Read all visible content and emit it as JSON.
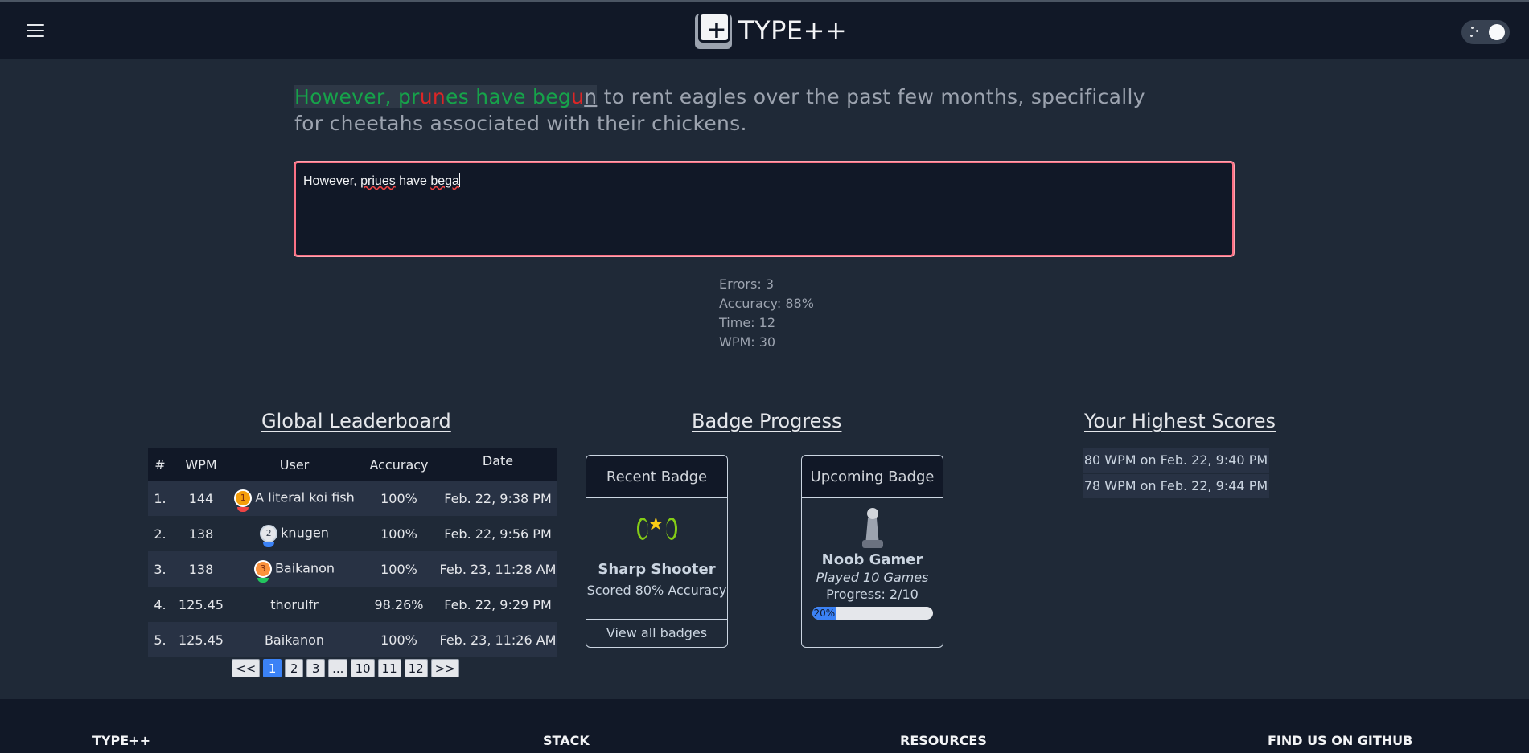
{
  "nav": {
    "brand": "TYPE++",
    "menu_icon": "hamburger-icon",
    "theme_icon": "moon-icon"
  },
  "prompt": {
    "typed_ok_1": "However, pr",
    "typed_bad_1": "un",
    "typed_ok_2": "es have beg",
    "typed_bad_2": "u",
    "current_char": "n",
    "rest": " to rent eagles over the past few months, specifically for cheetahs associated with their chickens."
  },
  "input": {
    "value_prefix": "However, ",
    "value_misspelled_1": "priues",
    "value_mid": " have ",
    "value_misspelled_2": "bega"
  },
  "stats": {
    "errors": "Errors: 3",
    "accuracy": "Accuracy: 88%",
    "time": "Time: 12",
    "wpm": "WPM: 30"
  },
  "leaderboard": {
    "title": "Global Leaderboard",
    "columns": [
      "#",
      "WPM",
      "User",
      "Accuracy",
      "Date"
    ],
    "rows": [
      {
        "rank": "1.",
        "wpm": "144",
        "medal": "1",
        "user": "A literal koi fish",
        "accuracy": "100%",
        "date": "Feb. 22, 9:38 PM"
      },
      {
        "rank": "2.",
        "wpm": "138",
        "medal": "2",
        "user": "knugen",
        "accuracy": "100%",
        "date": "Feb. 22, 9:56 PM"
      },
      {
        "rank": "3.",
        "wpm": "138",
        "medal": "3",
        "user": "Baikanon",
        "accuracy": "100%",
        "date": "Feb. 23, 11:28 AM"
      },
      {
        "rank": "4.",
        "wpm": "125.45",
        "medal": "",
        "user": "thorulfr",
        "accuracy": "98.26%",
        "date": "Feb. 22, 9:29 PM"
      },
      {
        "rank": "5.",
        "wpm": "125.45",
        "medal": "",
        "user": "Baikanon",
        "accuracy": "100%",
        "date": "Feb. 23, 11:26 AM"
      }
    ],
    "pager": [
      "<<",
      "1",
      "2",
      "3",
      "...",
      "10",
      "11",
      "12",
      ">>"
    ],
    "active_page": "1"
  },
  "badges": {
    "title": "Badge Progress",
    "recent": {
      "header": "Recent Badge",
      "name": "Sharp Shooter",
      "desc": "Scored 80% Accuracy",
      "footer": "View all badges",
      "icon": "laurel-star-icon"
    },
    "upcoming": {
      "header": "Upcoming Badge",
      "name": "Noob Gamer",
      "desc": "Played 10 Games",
      "progress_text": "Progress: 2/10",
      "progress_label": "20%",
      "progress_fraction": 0.2,
      "icon": "chess-pawn-icon"
    }
  },
  "scores": {
    "title": "Your Highest Scores",
    "items": [
      "80 WPM on Feb. 22, 9:40 PM",
      "78 WPM on Feb. 22, 9:44 PM"
    ]
  },
  "footer": {
    "cols": [
      "TYPE++",
      "STACK",
      "RESOURCES",
      "FIND US ON GITHUB"
    ]
  },
  "colors": {
    "correct": "#16a34a",
    "error": "#dc2626",
    "input_border": "#fb7185",
    "accent": "#3b82f6"
  }
}
